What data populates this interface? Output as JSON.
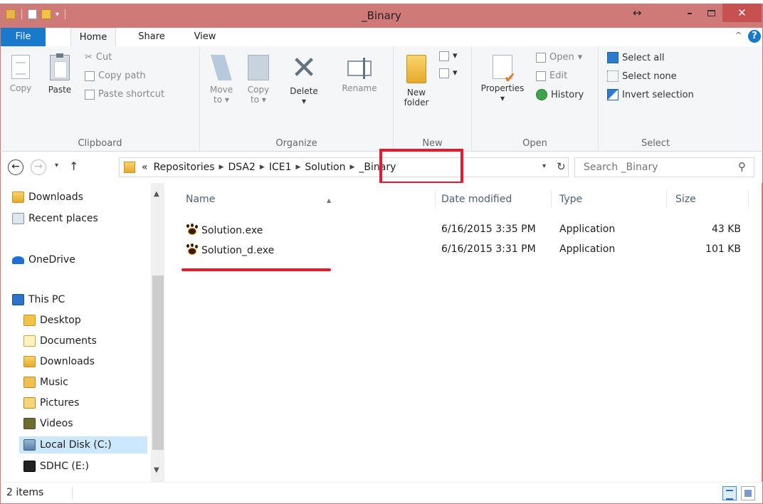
{
  "window": {
    "title": "_Binary"
  },
  "ribbon_tabs": [
    "File",
    "Home",
    "Share",
    "View"
  ],
  "ribbon": {
    "clipboard": {
      "label": "Clipboard",
      "copy": "Copy",
      "paste": "Paste",
      "cut": "Cut",
      "copy_path": "Copy path",
      "paste_shortcut": "Paste shortcut"
    },
    "organize": {
      "label": "Organize",
      "move_to_1": "Move",
      "move_to_2": "to",
      "copy_to_1": "Copy",
      "copy_to_2": "to",
      "delete": "Delete",
      "rename": "Rename"
    },
    "new": {
      "label": "New",
      "new_folder_1": "New",
      "new_folder_2": "folder"
    },
    "open": {
      "label": "Open",
      "properties": "Properties",
      "open": "Open",
      "edit": "Edit",
      "history": "History"
    },
    "select": {
      "label": "Select",
      "select_all": "Select all",
      "select_none": "Select none",
      "invert": "Invert selection"
    }
  },
  "address": {
    "overflow": "«",
    "segments": [
      "Repositories",
      "DSA2",
      "ICE1",
      "Solution",
      "_Binary"
    ],
    "search_placeholder": "Search _Binary"
  },
  "nav_pane": {
    "items": [
      {
        "label": "Downloads",
        "icon": "downloads-folder-icon"
      },
      {
        "label": "Recent places",
        "icon": "recent-places-icon"
      },
      {
        "label": "OneDrive",
        "icon": "onedrive-cloud-icon"
      },
      {
        "label": "This PC",
        "icon": "this-pc-icon"
      },
      {
        "label": "Desktop",
        "icon": "desktop-folder-icon"
      },
      {
        "label": "Documents",
        "icon": "documents-folder-icon"
      },
      {
        "label": "Downloads",
        "icon": "downloads-folder-icon"
      },
      {
        "label": "Music",
        "icon": "music-folder-icon"
      },
      {
        "label": "Pictures",
        "icon": "pictures-folder-icon"
      },
      {
        "label": "Videos",
        "icon": "videos-folder-icon"
      },
      {
        "label": "Local Disk (C:)",
        "icon": "local-disk-icon",
        "selected": true
      },
      {
        "label": "SDHC (E:)",
        "icon": "sd-card-icon"
      }
    ]
  },
  "file_list": {
    "columns": {
      "name": "Name",
      "date": "Date modified",
      "type": "Type",
      "size": "Size"
    },
    "rows": [
      {
        "name": "Solution.exe",
        "date": "6/16/2015 3:35 PM",
        "type": "Application",
        "size": "43 KB"
      },
      {
        "name": "Solution_d.exe",
        "date": "6/16/2015 3:31 PM",
        "type": "Application",
        "size": "101 KB"
      }
    ]
  },
  "status": {
    "count": "2 items"
  },
  "colors": {
    "title_bar": "#cf7a78",
    "file_tab": "#1979ca",
    "close_button": "#c75050",
    "annotation_red": "#e8192c"
  }
}
